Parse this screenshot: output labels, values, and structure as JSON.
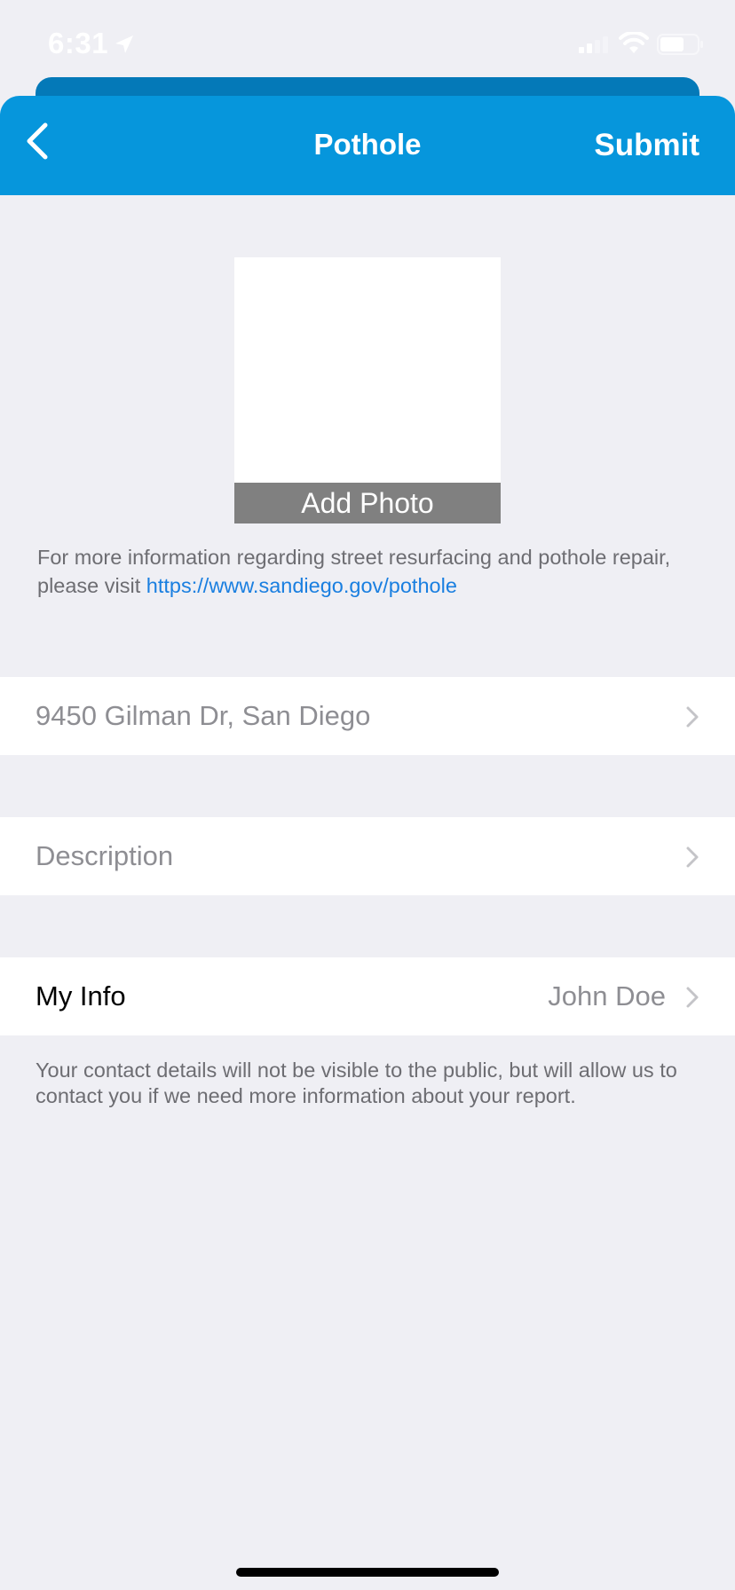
{
  "status_bar": {
    "time": "6:31",
    "icons": [
      "location-arrow-icon",
      "cellular-signal-icon",
      "wifi-icon",
      "battery-icon"
    ]
  },
  "nav": {
    "back_icon": "chevron-left-icon",
    "title": "Pothole",
    "submit_label": "Submit"
  },
  "photo": {
    "add_label": "Add Photo"
  },
  "info": {
    "text": "For more information regarding street resurfacing and pothole repair, please visit ",
    "link_text": "https://www.sandiego.gov/pothole"
  },
  "form": {
    "address": {
      "label": "9450 Gilman Dr, San Diego",
      "icon": "chevron-right-icon"
    },
    "description": {
      "label": "Description",
      "icon": "chevron-right-icon"
    },
    "my_info": {
      "label": "My Info",
      "value": "John Doe",
      "icon": "chevron-right-icon"
    }
  },
  "contact_note": "Your contact details will not be visible to the public, but will allow us to contact you if we need more information about your report.",
  "colors": {
    "nav_blue": "#0696dc",
    "nav_blue_back": "#0479b8",
    "link_blue": "#1a7fe0",
    "background": "#efeff4",
    "secondary_text": "#8e8e93"
  }
}
